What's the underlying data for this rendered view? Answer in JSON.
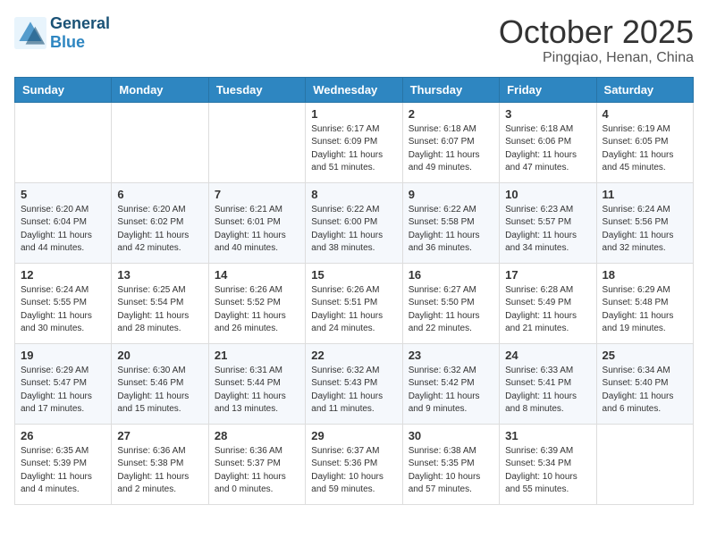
{
  "header": {
    "logo_text_general": "General",
    "logo_text_blue": "Blue",
    "month_title": "October 2025",
    "location": "Pingqiao, Henan, China"
  },
  "weekdays": [
    "Sunday",
    "Monday",
    "Tuesday",
    "Wednesday",
    "Thursday",
    "Friday",
    "Saturday"
  ],
  "weeks": [
    [
      {
        "day": "",
        "sunrise": "",
        "sunset": "",
        "daylight": ""
      },
      {
        "day": "",
        "sunrise": "",
        "sunset": "",
        "daylight": ""
      },
      {
        "day": "",
        "sunrise": "",
        "sunset": "",
        "daylight": ""
      },
      {
        "day": "1",
        "sunrise": "Sunrise: 6:17 AM",
        "sunset": "Sunset: 6:09 PM",
        "daylight": "Daylight: 11 hours and 51 minutes."
      },
      {
        "day": "2",
        "sunrise": "Sunrise: 6:18 AM",
        "sunset": "Sunset: 6:07 PM",
        "daylight": "Daylight: 11 hours and 49 minutes."
      },
      {
        "day": "3",
        "sunrise": "Sunrise: 6:18 AM",
        "sunset": "Sunset: 6:06 PM",
        "daylight": "Daylight: 11 hours and 47 minutes."
      },
      {
        "day": "4",
        "sunrise": "Sunrise: 6:19 AM",
        "sunset": "Sunset: 6:05 PM",
        "daylight": "Daylight: 11 hours and 45 minutes."
      }
    ],
    [
      {
        "day": "5",
        "sunrise": "Sunrise: 6:20 AM",
        "sunset": "Sunset: 6:04 PM",
        "daylight": "Daylight: 11 hours and 44 minutes."
      },
      {
        "day": "6",
        "sunrise": "Sunrise: 6:20 AM",
        "sunset": "Sunset: 6:02 PM",
        "daylight": "Daylight: 11 hours and 42 minutes."
      },
      {
        "day": "7",
        "sunrise": "Sunrise: 6:21 AM",
        "sunset": "Sunset: 6:01 PM",
        "daylight": "Daylight: 11 hours and 40 minutes."
      },
      {
        "day": "8",
        "sunrise": "Sunrise: 6:22 AM",
        "sunset": "Sunset: 6:00 PM",
        "daylight": "Daylight: 11 hours and 38 minutes."
      },
      {
        "day": "9",
        "sunrise": "Sunrise: 6:22 AM",
        "sunset": "Sunset: 5:58 PM",
        "daylight": "Daylight: 11 hours and 36 minutes."
      },
      {
        "day": "10",
        "sunrise": "Sunrise: 6:23 AM",
        "sunset": "Sunset: 5:57 PM",
        "daylight": "Daylight: 11 hours and 34 minutes."
      },
      {
        "day": "11",
        "sunrise": "Sunrise: 6:24 AM",
        "sunset": "Sunset: 5:56 PM",
        "daylight": "Daylight: 11 hours and 32 minutes."
      }
    ],
    [
      {
        "day": "12",
        "sunrise": "Sunrise: 6:24 AM",
        "sunset": "Sunset: 5:55 PM",
        "daylight": "Daylight: 11 hours and 30 minutes."
      },
      {
        "day": "13",
        "sunrise": "Sunrise: 6:25 AM",
        "sunset": "Sunset: 5:54 PM",
        "daylight": "Daylight: 11 hours and 28 minutes."
      },
      {
        "day": "14",
        "sunrise": "Sunrise: 6:26 AM",
        "sunset": "Sunset: 5:52 PM",
        "daylight": "Daylight: 11 hours and 26 minutes."
      },
      {
        "day": "15",
        "sunrise": "Sunrise: 6:26 AM",
        "sunset": "Sunset: 5:51 PM",
        "daylight": "Daylight: 11 hours and 24 minutes."
      },
      {
        "day": "16",
        "sunrise": "Sunrise: 6:27 AM",
        "sunset": "Sunset: 5:50 PM",
        "daylight": "Daylight: 11 hours and 22 minutes."
      },
      {
        "day": "17",
        "sunrise": "Sunrise: 6:28 AM",
        "sunset": "Sunset: 5:49 PM",
        "daylight": "Daylight: 11 hours and 21 minutes."
      },
      {
        "day": "18",
        "sunrise": "Sunrise: 6:29 AM",
        "sunset": "Sunset: 5:48 PM",
        "daylight": "Daylight: 11 hours and 19 minutes."
      }
    ],
    [
      {
        "day": "19",
        "sunrise": "Sunrise: 6:29 AM",
        "sunset": "Sunset: 5:47 PM",
        "daylight": "Daylight: 11 hours and 17 minutes."
      },
      {
        "day": "20",
        "sunrise": "Sunrise: 6:30 AM",
        "sunset": "Sunset: 5:46 PM",
        "daylight": "Daylight: 11 hours and 15 minutes."
      },
      {
        "day": "21",
        "sunrise": "Sunrise: 6:31 AM",
        "sunset": "Sunset: 5:44 PM",
        "daylight": "Daylight: 11 hours and 13 minutes."
      },
      {
        "day": "22",
        "sunrise": "Sunrise: 6:32 AM",
        "sunset": "Sunset: 5:43 PM",
        "daylight": "Daylight: 11 hours and 11 minutes."
      },
      {
        "day": "23",
        "sunrise": "Sunrise: 6:32 AM",
        "sunset": "Sunset: 5:42 PM",
        "daylight": "Daylight: 11 hours and 9 minutes."
      },
      {
        "day": "24",
        "sunrise": "Sunrise: 6:33 AM",
        "sunset": "Sunset: 5:41 PM",
        "daylight": "Daylight: 11 hours and 8 minutes."
      },
      {
        "day": "25",
        "sunrise": "Sunrise: 6:34 AM",
        "sunset": "Sunset: 5:40 PM",
        "daylight": "Daylight: 11 hours and 6 minutes."
      }
    ],
    [
      {
        "day": "26",
        "sunrise": "Sunrise: 6:35 AM",
        "sunset": "Sunset: 5:39 PM",
        "daylight": "Daylight: 11 hours and 4 minutes."
      },
      {
        "day": "27",
        "sunrise": "Sunrise: 6:36 AM",
        "sunset": "Sunset: 5:38 PM",
        "daylight": "Daylight: 11 hours and 2 minutes."
      },
      {
        "day": "28",
        "sunrise": "Sunrise: 6:36 AM",
        "sunset": "Sunset: 5:37 PM",
        "daylight": "Daylight: 11 hours and 0 minutes."
      },
      {
        "day": "29",
        "sunrise": "Sunrise: 6:37 AM",
        "sunset": "Sunset: 5:36 PM",
        "daylight": "Daylight: 10 hours and 59 minutes."
      },
      {
        "day": "30",
        "sunrise": "Sunrise: 6:38 AM",
        "sunset": "Sunset: 5:35 PM",
        "daylight": "Daylight: 10 hours and 57 minutes."
      },
      {
        "day": "31",
        "sunrise": "Sunrise: 6:39 AM",
        "sunset": "Sunset: 5:34 PM",
        "daylight": "Daylight: 10 hours and 55 minutes."
      },
      {
        "day": "",
        "sunrise": "",
        "sunset": "",
        "daylight": ""
      }
    ]
  ]
}
